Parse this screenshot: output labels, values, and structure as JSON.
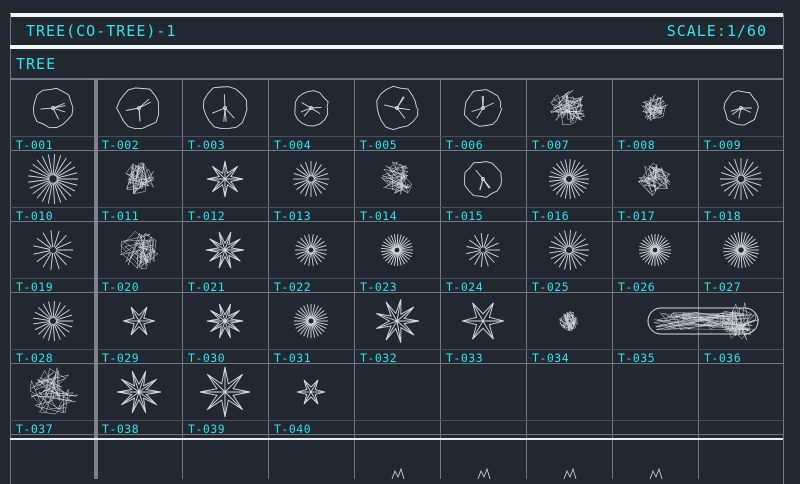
{
  "header": {
    "title": "TREE(CO-TREE)-1",
    "scale": "SCALE:1/60"
  },
  "section": {
    "title": "TREE"
  },
  "colors": {
    "background": "#212830",
    "accent": "#32e3ea",
    "line": "#6f7882",
    "symbol": "#d7dbe0"
  },
  "blocks": [
    {
      "code": "T-001",
      "icon": "tree-symbol-icon"
    },
    {
      "code": "T-002",
      "icon": "tree-symbol-icon"
    },
    {
      "code": "T-003",
      "icon": "tree-symbol-icon"
    },
    {
      "code": "T-004",
      "icon": "tree-symbol-icon"
    },
    {
      "code": "T-005",
      "icon": "tree-symbol-icon"
    },
    {
      "code": "T-006",
      "icon": "tree-symbol-icon"
    },
    {
      "code": "T-007",
      "icon": "tree-symbol-icon"
    },
    {
      "code": "T-008",
      "icon": "tree-symbol-icon"
    },
    {
      "code": "T-009",
      "icon": "tree-symbol-icon"
    },
    {
      "code": "T-010",
      "icon": "tree-symbol-icon"
    },
    {
      "code": "T-011",
      "icon": "tree-symbol-icon"
    },
    {
      "code": "T-012",
      "icon": "tree-symbol-icon"
    },
    {
      "code": "T-013",
      "icon": "tree-symbol-icon"
    },
    {
      "code": "T-014",
      "icon": "tree-symbol-icon"
    },
    {
      "code": "T-015",
      "icon": "tree-symbol-icon"
    },
    {
      "code": "T-016",
      "icon": "tree-symbol-icon"
    },
    {
      "code": "T-017",
      "icon": "tree-symbol-icon"
    },
    {
      "code": "T-018",
      "icon": "tree-symbol-icon"
    },
    {
      "code": "T-019",
      "icon": "tree-symbol-icon"
    },
    {
      "code": "T-020",
      "icon": "tree-symbol-icon"
    },
    {
      "code": "T-021",
      "icon": "tree-symbol-icon"
    },
    {
      "code": "T-022",
      "icon": "tree-symbol-icon"
    },
    {
      "code": "T-023",
      "icon": "tree-symbol-icon"
    },
    {
      "code": "T-024",
      "icon": "tree-symbol-icon"
    },
    {
      "code": "T-025",
      "icon": "tree-symbol-icon"
    },
    {
      "code": "T-026",
      "icon": "tree-symbol-icon"
    },
    {
      "code": "T-027",
      "icon": "tree-symbol-icon"
    },
    {
      "code": "T-028",
      "icon": "tree-symbol-icon"
    },
    {
      "code": "T-029",
      "icon": "tree-symbol-icon"
    },
    {
      "code": "T-030",
      "icon": "tree-symbol-icon"
    },
    {
      "code": "T-031",
      "icon": "tree-symbol-icon"
    },
    {
      "code": "T-032",
      "icon": "tree-symbol-icon"
    },
    {
      "code": "T-033",
      "icon": "tree-symbol-icon"
    },
    {
      "code": "T-034",
      "icon": "tree-symbol-icon"
    },
    {
      "code": "T-035",
      "icon": "hedge-symbol-icon"
    },
    {
      "code": "T-036",
      "icon": "tree-symbol-icon"
    },
    {
      "code": "T-037",
      "icon": "tree-symbol-icon"
    },
    {
      "code": "T-038",
      "icon": "tree-symbol-icon"
    },
    {
      "code": "T-039",
      "icon": "tree-symbol-icon"
    },
    {
      "code": "T-040",
      "icon": "tree-symbol-icon"
    }
  ]
}
